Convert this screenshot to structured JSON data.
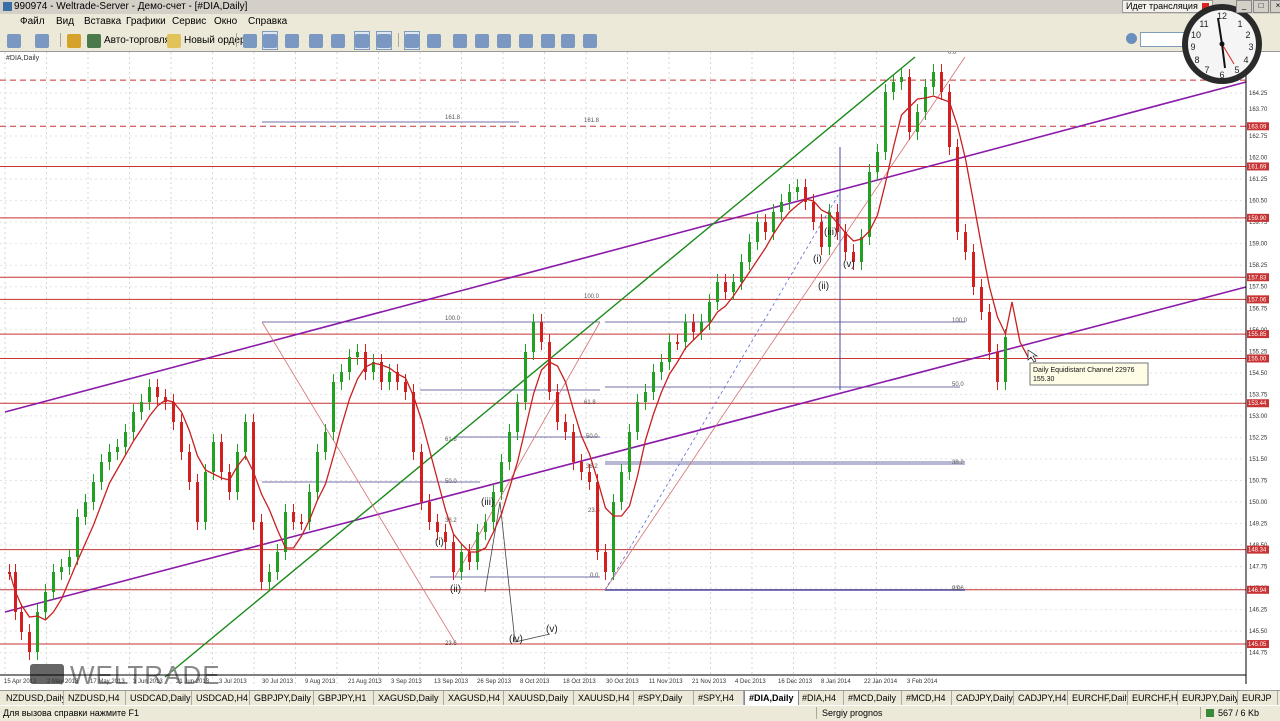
{
  "window": {
    "title": "990974 - Weltrade-Server - Демо-счет - [#DIA,Daily]"
  },
  "broadcast": {
    "label": "Идет трансляция"
  },
  "menu": [
    "Файл",
    "Вид",
    "Вставка",
    "Графики",
    "Сервис",
    "Окно",
    "Справка"
  ],
  "toolbar": {
    "autotrade_label": "Авто-торговля",
    "new_order_label": "Новый ордер"
  },
  "chart": {
    "symbol_label": "#DIA,Daily",
    "price_ticks": [
      "164.25",
      "163.70",
      "162.75",
      "162.00",
      "161.25",
      "160.50",
      "159.75",
      "159.00",
      "158.25",
      "157.50",
      "156.75",
      "156.00",
      "155.25",
      "154.50",
      "153.75",
      "153.00",
      "152.25",
      "151.50",
      "150.75",
      "150.00",
      "149.25",
      "148.50",
      "147.75",
      "147.00",
      "146.25",
      "145.50",
      "144.75"
    ],
    "price_markers": [
      {
        "label": "163.09",
        "color": "#c83232"
      },
      {
        "label": "161.69",
        "color": "#c83232"
      },
      {
        "label": "159.90",
        "color": "#c83232"
      },
      {
        "label": "157.83",
        "color": "#c83232"
      },
      {
        "label": "157.06",
        "color": "#c83232"
      },
      {
        "label": "155.85",
        "color": "#c83232"
      },
      {
        "label": "155.00",
        "color": "#c83232"
      },
      {
        "label": "153.44",
        "color": "#c83232"
      },
      {
        "label": "148.34",
        "color": "#c83232"
      },
      {
        "label": "146.94",
        "color": "#c83232"
      },
      {
        "label": "145.05",
        "color": "#c83232"
      }
    ],
    "date_labels": [
      "15 Apr 2013",
      "2 May 2013",
      "17 May 2013",
      "3 Jun 2013",
      "21 Jun 2013",
      "3 Jul 2013",
      "30 Jul 2013",
      "9 Aug 2013",
      "21 Aug 2013",
      "3 Sep 2013",
      "13 Sep 2013",
      "26 Sep 2013",
      "8 Oct 2013",
      "18 Oct 2013",
      "30 Oct 2013",
      "11 Nov 2013",
      "21 Nov 2013",
      "4 Dec 2013",
      "16 Dec 2013",
      "8 Jan 2014",
      "22 Jan 2014",
      "3 Feb 2014"
    ],
    "fib_labels": [
      "161.8",
      "161.8",
      "100.0",
      "100.0",
      "61.8",
      "61.8",
      "50.0",
      "50.0",
      "38.2",
      "38.2",
      "23.6",
      "23.6",
      "0.0",
      "0.0",
      "100.0",
      "50.0",
      "38.2",
      "23.6",
      "0.0"
    ],
    "wave_labels": [
      "(i)",
      "(ii)",
      "(iii)",
      "(iv)",
      "(v)",
      "(iii)",
      "(i)",
      "(ii)",
      "(v)"
    ],
    "tooltip": {
      "line1": "Daily Equidistant Channel 22976",
      "line2": "155.30"
    },
    "watermark": "WELTRADE",
    "colors": {
      "bull": "#22a022",
      "bear": "#d22020",
      "ma": "#c82020",
      "channel": "#8a1aa8",
      "trend": "#1a8a1a",
      "hline": "#c83232"
    }
  },
  "tabs": [
    "NZDUSD,Daily",
    "NZDUSD,H4",
    "USDCAD,Daily",
    "USDCAD,H4",
    "GBPJPY,Daily",
    "GBPJPY,H1",
    "XAGUSD,Daily",
    "XAGUSD,H4",
    "XAUUSD,Daily",
    "XAUUSD,H4",
    "#SPY,Daily",
    "#SPY,H4",
    "#DIA,Daily",
    "#DIA,H4",
    "#MCD,Daily",
    "#MCD,H4",
    "CADJPY,Daily",
    "CADJPY,H4",
    "EURCHF,Daily",
    "EURCHF,H4",
    "EURJPY,Daily",
    "EURJP"
  ],
  "active_tab": "#DIA,Daily",
  "status": {
    "help": "Для вызова справки нажмите F1",
    "profile": "Sergiy prognos",
    "traffic": "567 / 6 Kb"
  }
}
